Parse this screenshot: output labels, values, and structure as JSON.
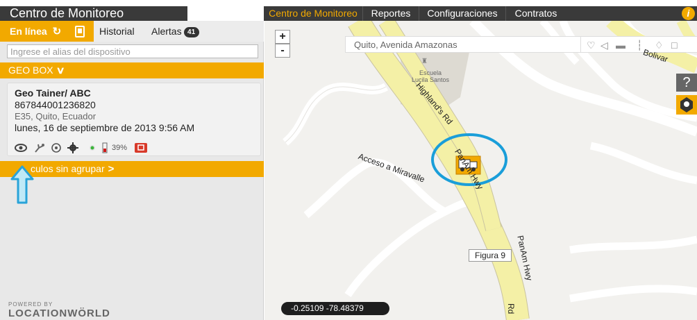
{
  "header": {
    "app_title": "Centro de Monitoreo",
    "nav": [
      "Centro de Monitoreo",
      "Reportes",
      "Configuraciones",
      "Contratos"
    ],
    "info_icon": "i",
    "accent_color": "#f2a900",
    "bar_color": "#3a3a3a"
  },
  "panel": {
    "tabs": {
      "online": "En línea",
      "history": "Historial",
      "alerts": "Alertas",
      "alerts_count": "41"
    },
    "search_placeholder": "Ingrese el alias del dispositivo",
    "group_label": "GEO BOX",
    "device": {
      "name": "Geo Tainer/ ABC",
      "imei": "867844001236820",
      "address": "E35, Quito, Ecuador",
      "datetime": "lunes, 16 de septiembre de 2013 9:56 AM",
      "battery": "39%"
    },
    "ungrouped_label": "culos sin agrupar",
    "powered_by": "POWERED BY",
    "brand": "LOCATIONWÖRLD"
  },
  "map": {
    "zoom_in": "+",
    "zoom_out": "-",
    "search_value": "Quito, Avenida Amazonas",
    "help_icon": "?",
    "figure_label": "Figura 9",
    "coords": "-0.25109   -78.48379",
    "roads": {
      "highland": "Highland's Rd",
      "panam": "PanAm Hwy",
      "panam2": "PanAm Hwy",
      "acceso": "Acceso a Miravalle",
      "bolivar": "Bolivar",
      "rd": "Rd"
    },
    "poi": {
      "school_line1": "Escuela",
      "school_line2": "Lucila Santos"
    }
  }
}
